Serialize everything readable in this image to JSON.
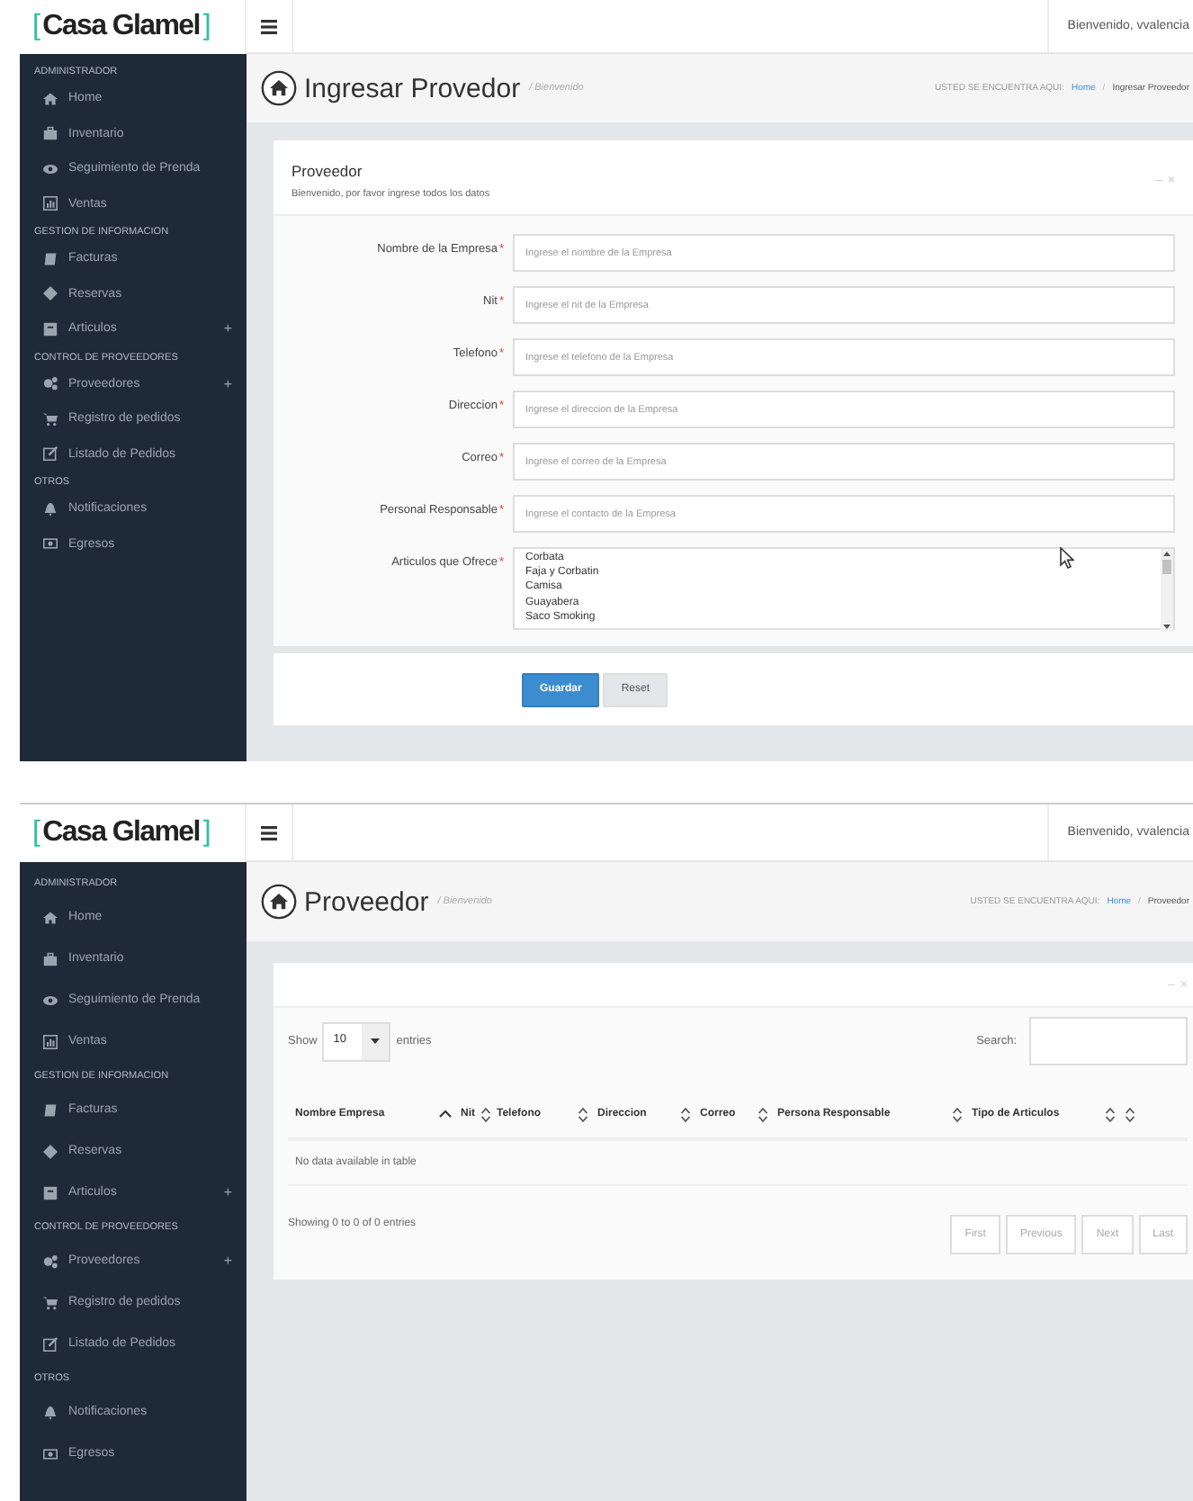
{
  "screens": [
    {
      "kind": "form",
      "logo": {
        "open": "[",
        "name": "Casa Glamel",
        "close": "]"
      },
      "user_greeting": "Bienvenido, vvalencia",
      "sidebar": [
        {
          "heading": "ADMINISTRADOR",
          "items": [
            {
              "label": "Home"
            },
            {
              "label": "Inventario"
            },
            {
              "label": "Seguimiento de Prenda"
            },
            {
              "label": "Ventas"
            }
          ]
        },
        {
          "heading": "GESTION DE INFORMACION",
          "items": [
            {
              "label": "Facturas"
            },
            {
              "label": "Reservas"
            },
            {
              "label": "Articulos",
              "expander": "+"
            }
          ]
        },
        {
          "heading": "CONTROL DE PROVEEDORES",
          "items": [
            {
              "label": "Proveedores",
              "expander": "+"
            },
            {
              "label": "Registro de pedidos"
            },
            {
              "label": "Listado de Pedidos"
            }
          ]
        },
        {
          "heading": "OTROS",
          "items": [
            {
              "label": "Notificaciones"
            },
            {
              "label": "Egresos"
            }
          ]
        }
      ],
      "page_title": "Ingresar Provedor",
      "title_separator": "/",
      "page_subtitle": "Bienvenido",
      "breadcrumb": {
        "label": "USTED SE ENCUENTRA AQUI:",
        "link": "Home",
        "separator": "/",
        "current": "Ingresar Proveedor"
      },
      "panel": {
        "title": "Proveedor",
        "subtitle": "Bienvenido, por favor ingrese todos los datos",
        "controls": [
          "–",
          "×"
        ],
        "fields": [
          {
            "kind": "text",
            "label": "Nombre de la Empresa",
            "mark": "*",
            "placeholder": "Ingrese el nombre de la Empresa"
          },
          {
            "kind": "text",
            "label": "Nit",
            "mark": "*",
            "placeholder": "Ingrese el nit de la Empresa"
          },
          {
            "kind": "text",
            "label": "Telefono",
            "mark": "*",
            "placeholder": "Ingrese el telefono de la Empresa"
          },
          {
            "kind": "text",
            "label": "Direccion",
            "mark": "*",
            "placeholder": "Ingrese el direccion de la Empresa"
          },
          {
            "kind": "text",
            "label": "Correo",
            "mark": "*",
            "placeholder": "Ingrese el correo de la Empresa"
          },
          {
            "kind": "text",
            "label": "Personal Responsable",
            "mark": "*",
            "placeholder": "Ingrese el contacto de la Empresa"
          },
          {
            "kind": "listbox",
            "label": "Articulos que Ofrece",
            "mark": "*",
            "options": [
              "Corbata",
              "Faja y Corbatin",
              "Camisa",
              "Guayabera",
              "Saco Smoking"
            ]
          }
        ],
        "buttons": [
          {
            "label": "Guardar",
            "kind": "primary"
          },
          {
            "label": "Reset",
            "kind": "default"
          }
        ]
      }
    },
    {
      "kind": "table",
      "logo": {
        "open": "[",
        "name": "Casa Glamel",
        "close": "]"
      },
      "user_greeting": "Bienvenido, vvalencia",
      "sidebar": [
        {
          "heading": "ADMINISTRADOR",
          "items": [
            {
              "label": "Home"
            },
            {
              "label": "Inventario"
            },
            {
              "label": "Seguimiento de Prenda"
            },
            {
              "label": "Ventas"
            }
          ]
        },
        {
          "heading": "GESTION DE INFORMACION",
          "items": [
            {
              "label": "Facturas"
            },
            {
              "label": "Reservas"
            },
            {
              "label": "Articulos",
              "expander": "+"
            }
          ]
        },
        {
          "heading": "CONTROL DE PROVEEDORES",
          "items": [
            {
              "label": "Proveedores",
              "expander": "+"
            },
            {
              "label": "Registro de pedidos"
            },
            {
              "label": "Listado de Pedidos"
            }
          ]
        },
        {
          "heading": "OTROS",
          "items": [
            {
              "label": "Notificaciones"
            },
            {
              "label": "Egresos"
            }
          ]
        }
      ],
      "page_title": "Proveedor",
      "title_separator": "/",
      "page_subtitle": "Bienvenido",
      "breadcrumb": {
        "label": "USTED SE ENCUENTRA AQUI:",
        "link": "Home",
        "separator": "/",
        "current": "Proveedor"
      },
      "panel": {
        "controls": [
          "–",
          "×"
        ],
        "show_label": "Show",
        "page_size": "10",
        "entries_label": "entries",
        "search_label": "Search:",
        "columns": [
          {
            "name": "Nombre Empresa",
            "sorted": true
          },
          {
            "name": "Nit",
            "sorted": false
          },
          {
            "name": "Telefono",
            "sorted": false
          },
          {
            "name": "Direccion",
            "sorted": false
          },
          {
            "name": "Correo",
            "sorted": false
          },
          {
            "name": "Persona Responsable",
            "sorted": false
          },
          {
            "name": "Tipo de Articulos",
            "sorted": false
          },
          {
            "sorted": false
          }
        ],
        "empty_message": "No data available in table",
        "info": "Showing 0 to 0 of 0 entries",
        "pager": [
          {
            "label": "First",
            "disabled": true
          },
          {
            "label": "Previous",
            "disabled": true
          },
          {
            "label": "Next",
            "disabled": true
          },
          {
            "label": "Last",
            "disabled": true
          }
        ]
      }
    }
  ]
}
